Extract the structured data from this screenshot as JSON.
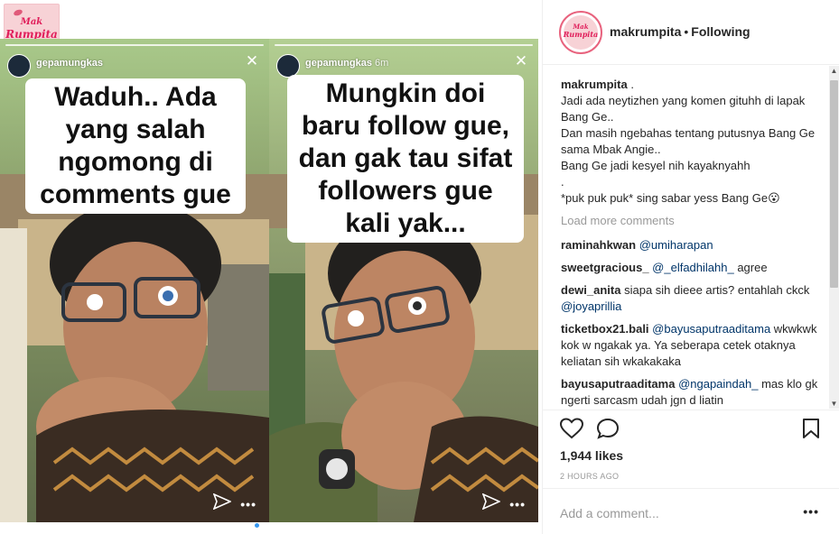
{
  "media": {
    "logo_line1": "Mak",
    "logo_line2": "Rumpita",
    "stories": [
      {
        "handle": "gepamungkas",
        "caption": "Waduh.. Ada yang salah ngomong di comments gue"
      },
      {
        "handle": "gepamungkas",
        "time": "6m",
        "caption": "Mungkin doi baru follow gue, dan gak tau sifat followers gue kali yak..."
      }
    ]
  },
  "header": {
    "username": "makrumpita",
    "separator": "•",
    "follow_status": "Following",
    "avatar_line1": "Mak",
    "avatar_line2": "Rumpita"
  },
  "caption": {
    "username": "makrumpita",
    "text": " .\nJadi ada neytizhen yang komen gituhh di lapak Bang Ge..\nDan masih ngebahas tentang putusnya Bang Ge sama Mbak Angie..\nBang Ge jadi kesyel nih kayaknyahh\n.\n*puk puk puk* sing sabar yess Bang Ge😮"
  },
  "load_more": "Load more comments",
  "comments": [
    {
      "user": "raminahkwan",
      "mention": "@umiharapan",
      "text": ""
    },
    {
      "user": "sweetgracious_",
      "mention": "@_elfadhilahh_",
      "text": " agree"
    },
    {
      "user": "dewi_anita",
      "mention": "",
      "text": "siapa sih dieee artis? entahlah ckck ",
      "mention_after": "@joyaprillia"
    },
    {
      "user": "ticketbox21.bali",
      "mention": "@bayusaputraaditama",
      "text": " wkwkwk kok w ngakak ya. Ya seberapa cetek otaknya keliatan sih wkakakaka"
    },
    {
      "user": "bayusaputraaditama",
      "mention": "@ngapaindah_",
      "text": " mas klo gk ngerti sarcasm udah jgn d liatin"
    }
  ],
  "actions": {
    "likes": "1,944 likes",
    "time": "2 HOURS AGO"
  },
  "add_comment": {
    "placeholder": "Add a comment...",
    "options": "•••"
  },
  "colors": {
    "mention": "#003569",
    "muted": "#999999",
    "border": "#efefef",
    "brand_pink": "#e01e5a"
  },
  "icons": {
    "like": "heart-icon",
    "comment": "comment-icon",
    "save": "bookmark-icon",
    "share": "send-icon",
    "close": "close-icon"
  }
}
